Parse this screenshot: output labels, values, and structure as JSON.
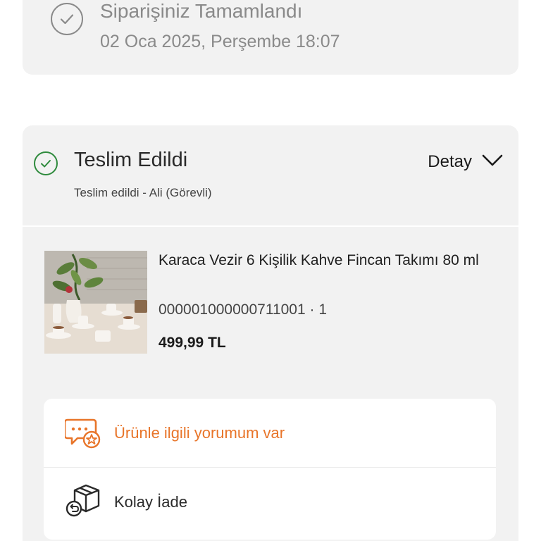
{
  "status": {
    "title": "Siparişiniz Tamamlandı",
    "date": "02 Oca 2025, Perşembe 18:07"
  },
  "delivery": {
    "title": "Teslim Edildi",
    "detail_label": "Detay",
    "subtitle": "Teslim edildi - Ali (Görevli)"
  },
  "product": {
    "name": "Karaca Vezir 6 Kişilik Kahve Fincan Takımı 80 ml",
    "code": "000001000000711001 · 1",
    "price": "499,99 TL"
  },
  "actions": {
    "review_label": "Ürünle ilgili yorumum var",
    "return_label": "Kolay İade"
  },
  "colors": {
    "accent": "#e8752a",
    "success": "#2e8a3c",
    "card_bg": "#f2f2f2"
  },
  "icons": {
    "status": "check-circle-icon",
    "delivered": "check-circle-icon",
    "detail": "chevron-down-icon",
    "review": "review-chat-star-icon",
    "return": "return-box-icon"
  }
}
